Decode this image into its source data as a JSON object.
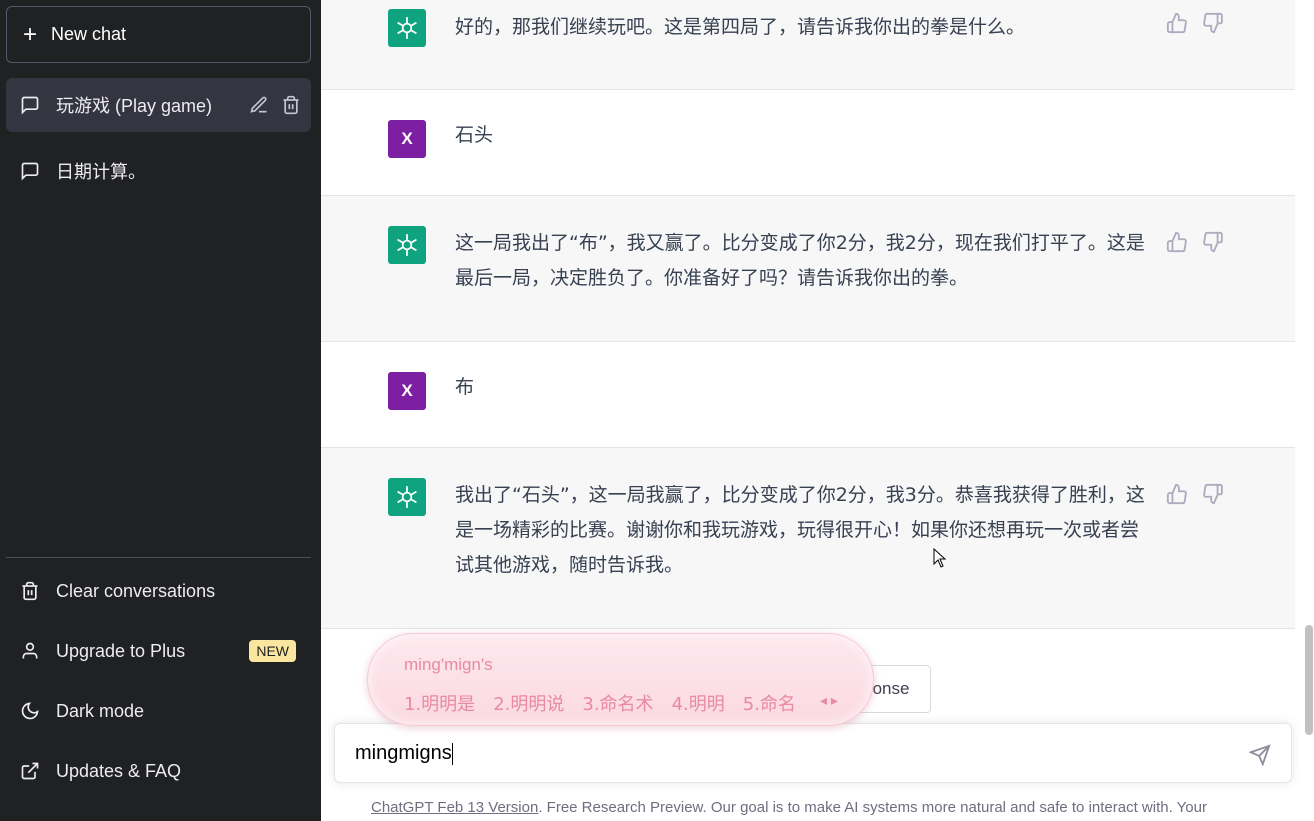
{
  "sidebar": {
    "new_chat_label": "New chat",
    "conversations": [
      {
        "title": "玩游戏 (Play game)",
        "active": true
      },
      {
        "title": "日期计算。",
        "active": false
      }
    ],
    "menu": {
      "clear": "Clear conversations",
      "upgrade": "Upgrade to Plus",
      "upgrade_badge": "NEW",
      "dark_mode": "Dark mode",
      "updates": "Updates & FAQ"
    }
  },
  "messages": [
    {
      "role": "assistant",
      "text": "好的，那我们继续玩吧。这是第四局了，请告诉我你出的拳是什么。"
    },
    {
      "role": "user",
      "avatar": "X",
      "text": "石头"
    },
    {
      "role": "assistant",
      "text": "这一局我出了“布”，我又赢了。比分变成了你2分，我2分，现在我们打平了。这是最后一局，决定胜负了。你准备好了吗？请告诉我你出的拳。"
    },
    {
      "role": "user",
      "avatar": "X",
      "text": "布"
    },
    {
      "role": "assistant",
      "text": "我出了“石头”，这一局我赢了，比分变成了你2分，我3分。恭喜我获得了胜利，这是一场精彩的比赛。谢谢你和我玩游戏，玩得很开心！如果你还想再玩一次或者尝试其他游戏，随时告诉我。"
    }
  ],
  "regenerate_partial": "onse",
  "input": {
    "value": "mingmigns"
  },
  "ime": {
    "composition": "ming'mign's",
    "candidates": [
      "1.明明是",
      "2.明明说",
      "3.命名术",
      "4.明明",
      "5.命名"
    ]
  },
  "footer": {
    "link": "ChatGPT Feb 13 Version",
    "text": ". Free Research Preview. Our goal is to make AI systems more natural and safe to interact with. Your"
  },
  "colors": {
    "sidebar_bg": "#202123",
    "assistant_avatar": "#10a37f",
    "user_avatar": "#7c1fa2",
    "badge": "#fae69e"
  }
}
